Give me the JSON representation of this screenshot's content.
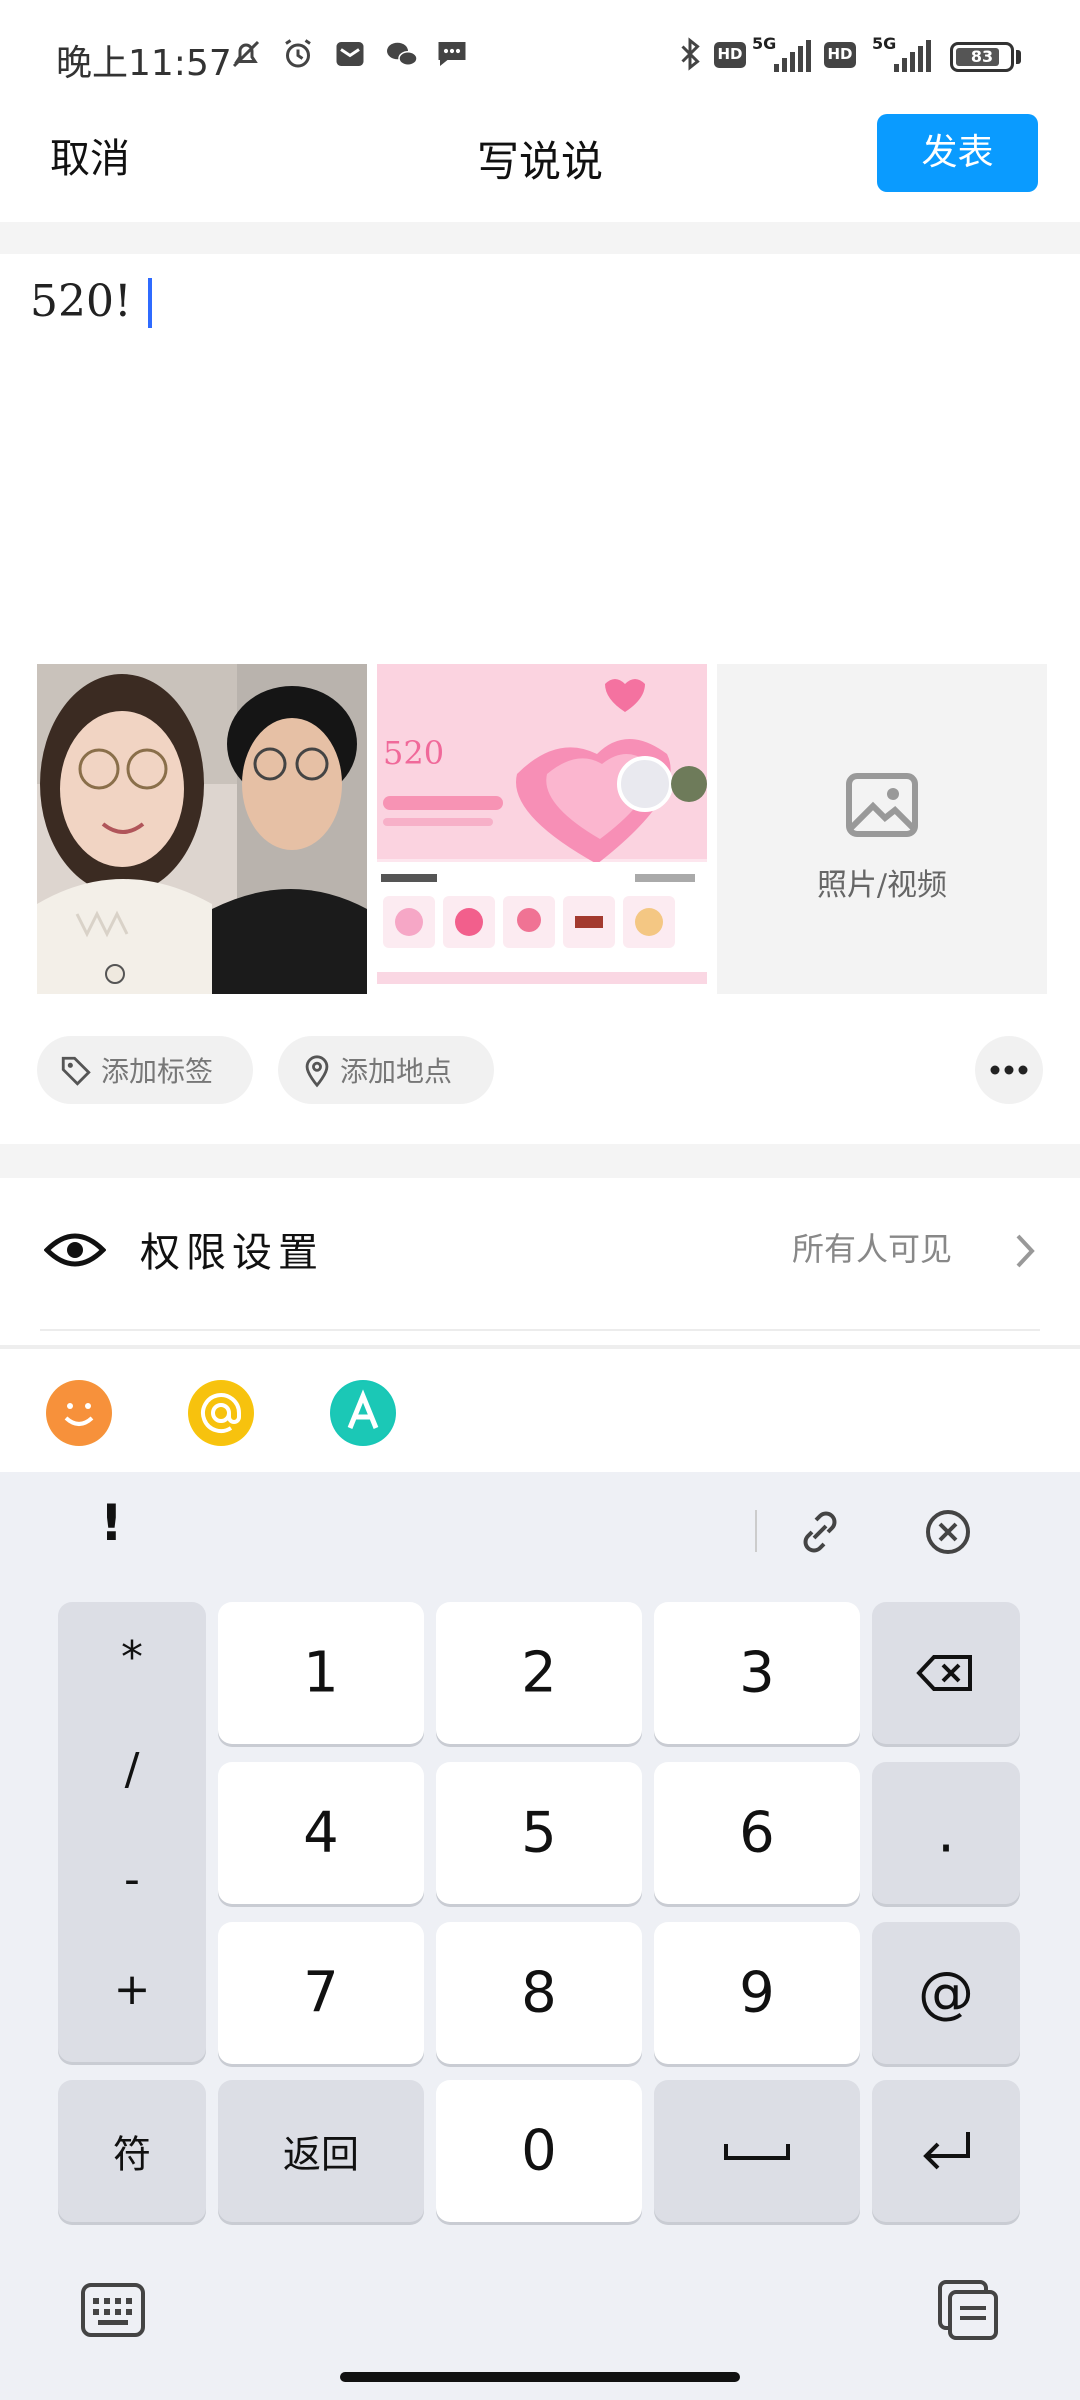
{
  "status_bar": {
    "time": "晚上11:57",
    "net1": "5G",
    "hd1": "HD",
    "net2": "5G",
    "hd2": "HD",
    "battery": "83",
    "battery_level": 0.83
  },
  "nav": {
    "cancel": "取消",
    "title": "写说说",
    "publish": "发表",
    "accent": "#0a9bff"
  },
  "compose": {
    "text": "520!"
  },
  "media": {
    "add_label": "照片/视频"
  },
  "chips": {
    "tag": "添加标签",
    "location": "添加地点"
  },
  "permission": {
    "label": "权限设置",
    "value": "所有人可见"
  },
  "toolbar": {
    "items": [
      "emoji-icon",
      "mention-icon",
      "font-icon"
    ]
  },
  "keyboard": {
    "suggestion": "!",
    "symbols": [
      "*",
      "/",
      "-",
      "+"
    ],
    "digits": [
      "1",
      "2",
      "3",
      "4",
      "5",
      "6",
      "7",
      "8",
      "9",
      "0"
    ],
    "dot": ".",
    "at": "@",
    "fu": "符",
    "back": "返回"
  }
}
